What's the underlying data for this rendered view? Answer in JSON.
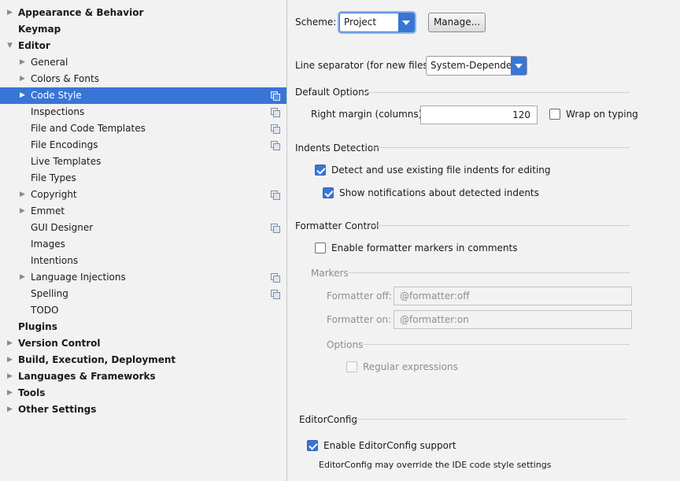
{
  "sidebar": {
    "items": [
      {
        "label": "Appearance & Behavior",
        "level": 0,
        "expanded": false,
        "arrow": "right",
        "copy": false
      },
      {
        "label": "Keymap",
        "level": 0,
        "arrow": "none",
        "copy": false
      },
      {
        "label": "Editor",
        "level": 0,
        "arrow": "down",
        "copy": false
      },
      {
        "label": "General",
        "level": 1,
        "arrow": "right",
        "copy": false
      },
      {
        "label": "Colors & Fonts",
        "level": 1,
        "arrow": "right",
        "copy": false
      },
      {
        "label": "Code Style",
        "level": 1,
        "arrow": "right",
        "copy": true,
        "selected": true
      },
      {
        "label": "Inspections",
        "level": 1,
        "arrow": "none",
        "copy": true
      },
      {
        "label": "File and Code Templates",
        "level": 1,
        "arrow": "none",
        "copy": true
      },
      {
        "label": "File Encodings",
        "level": 1,
        "arrow": "none",
        "copy": true
      },
      {
        "label": "Live Templates",
        "level": 1,
        "arrow": "none",
        "copy": false
      },
      {
        "label": "File Types",
        "level": 1,
        "arrow": "none",
        "copy": false
      },
      {
        "label": "Copyright",
        "level": 1,
        "arrow": "right",
        "copy": true
      },
      {
        "label": "Emmet",
        "level": 1,
        "arrow": "right",
        "copy": false
      },
      {
        "label": "GUI Designer",
        "level": 1,
        "arrow": "none",
        "copy": true
      },
      {
        "label": "Images",
        "level": 1,
        "arrow": "none",
        "copy": false
      },
      {
        "label": "Intentions",
        "level": 1,
        "arrow": "none",
        "copy": false
      },
      {
        "label": "Language Injections",
        "level": 1,
        "arrow": "right",
        "copy": true
      },
      {
        "label": "Spelling",
        "level": 1,
        "arrow": "none",
        "copy": true
      },
      {
        "label": "TODO",
        "level": 1,
        "arrow": "none",
        "copy": false
      },
      {
        "label": "Plugins",
        "level": 0,
        "arrow": "none",
        "copy": false
      },
      {
        "label": "Version Control",
        "level": 0,
        "arrow": "right",
        "copy": false
      },
      {
        "label": "Build, Execution, Deployment",
        "level": 0,
        "arrow": "right",
        "copy": false
      },
      {
        "label": "Languages & Frameworks",
        "level": 0,
        "arrow": "right",
        "copy": false
      },
      {
        "label": "Tools",
        "level": 0,
        "arrow": "right",
        "copy": false
      },
      {
        "label": "Other Settings",
        "level": 0,
        "arrow": "right",
        "copy": false
      }
    ]
  },
  "scheme": {
    "label": "Scheme:",
    "value": "Project",
    "manage_label": "Manage..."
  },
  "line_separator": {
    "label": "Line separator (for new files):",
    "value": "System-Dependent"
  },
  "default_options": {
    "title": "Default Options",
    "right_margin_label": "Right margin (columns):",
    "right_margin_value": "120",
    "wrap_on_typing_label": "Wrap on typing",
    "wrap_on_typing_checked": false
  },
  "indents_detection": {
    "title": "Indents Detection",
    "detect_label": "Detect and use existing file indents for editing",
    "detect_checked": true,
    "notify_label": "Show notifications about detected indents",
    "notify_checked": true
  },
  "formatter_control": {
    "title": "Formatter Control",
    "enable_label": "Enable formatter markers in comments",
    "enable_checked": false,
    "markers_title": "Markers",
    "off_label": "Formatter off:",
    "off_value": "@formatter:off",
    "on_label": "Formatter on:",
    "on_value": "@formatter:on",
    "options_title": "Options",
    "regex_label": "Regular expressions",
    "regex_checked": false
  },
  "editorconfig": {
    "title": "EditorConfig",
    "enable_label": "Enable EditorConfig support",
    "enable_checked": true,
    "note": "EditorConfig may override the IDE code style settings"
  },
  "colors": {
    "selection": "#3875d6",
    "background": "#f2f2f2"
  }
}
